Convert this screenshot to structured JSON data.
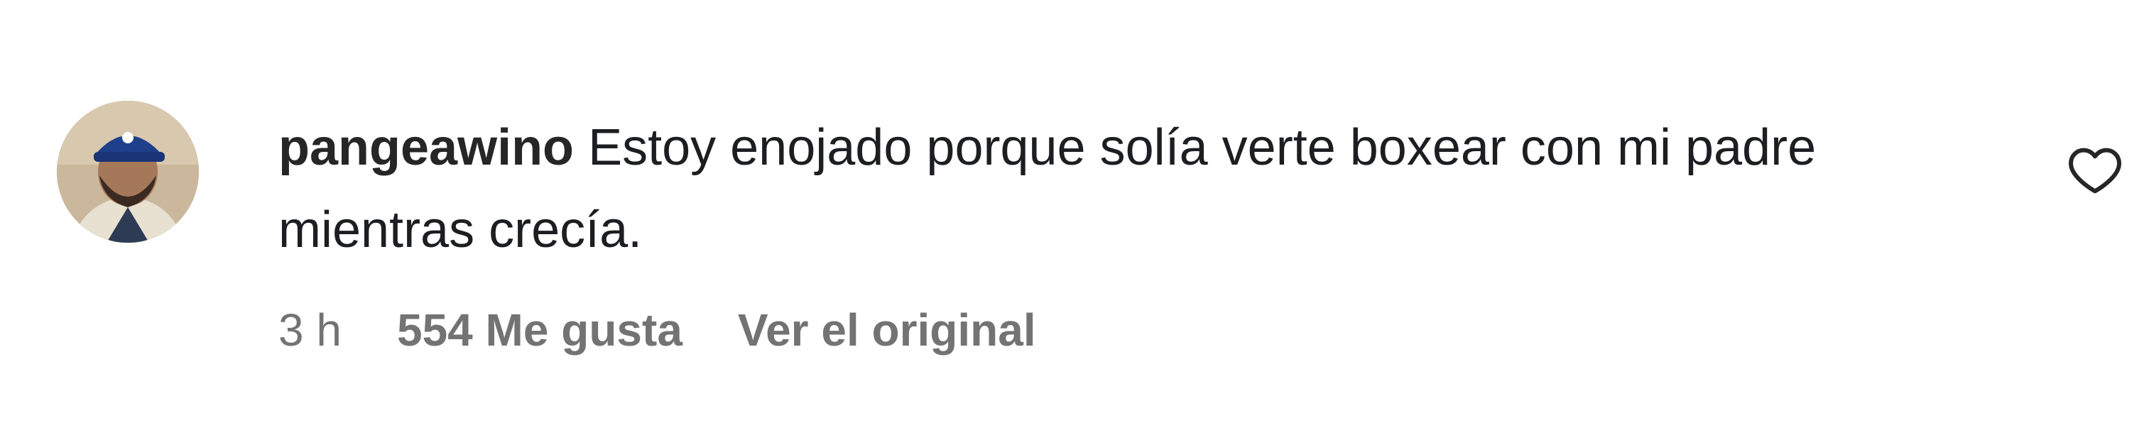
{
  "comment": {
    "username": "pangeawino",
    "text": "Estoy enojado porque solía verte boxear con mi padre mientras crecía.",
    "time": "3 h",
    "likes": "554 Me gusta",
    "translate_link": "Ver el original"
  },
  "icons": {
    "like": "heart-outline-icon",
    "avatar": "user-avatar"
  },
  "colors": {
    "text": "#1c1e21",
    "meta": "#737373",
    "username": "#262626"
  }
}
